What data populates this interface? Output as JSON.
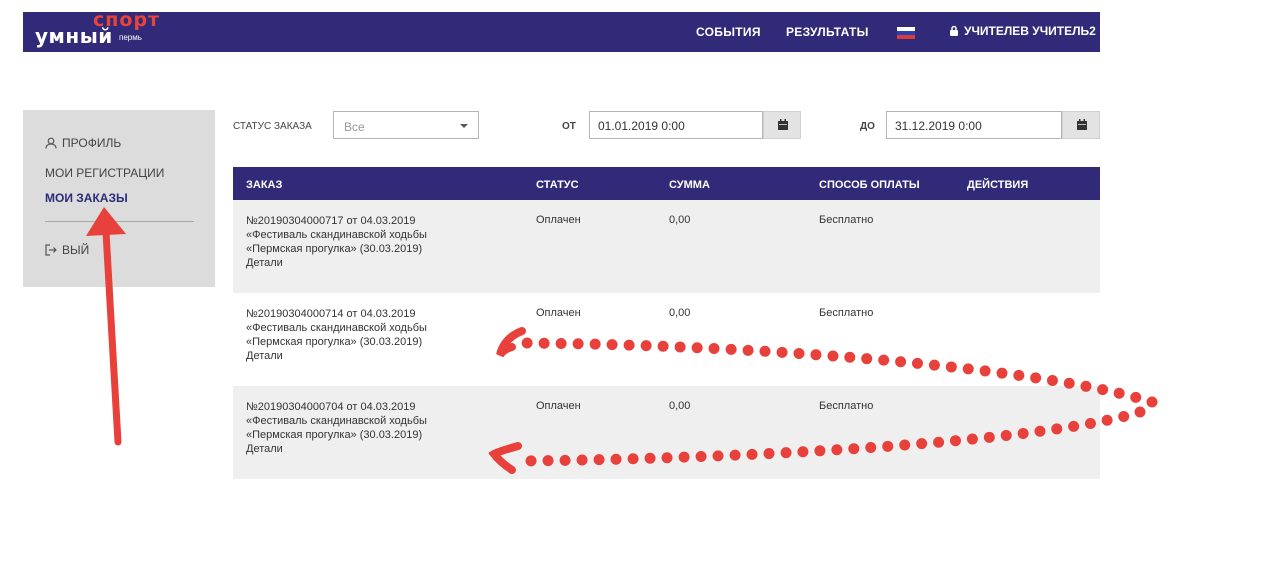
{
  "header": {
    "logo_main": "умный",
    "logo_sport": "спорт",
    "logo_city": "пермь",
    "nav": [
      {
        "label": "СОБЫТИЯ"
      },
      {
        "label": "РЕЗУЛЬТАТЫ"
      }
    ],
    "language_flag_icon": "russia-flag-icon",
    "user_icon": "lock-icon",
    "user_name": "УЧИТЕЛЕВ УЧИТЕЛЬ2"
  },
  "sidebar": {
    "items": [
      {
        "label": "ПРОФИЛЬ",
        "icon": "user-icon"
      },
      {
        "label": "МОИ РЕГИСТРАЦИИ"
      },
      {
        "label": "МОИ ЗАКАЗЫ",
        "active": true
      },
      {
        "label": "ВЫЙ",
        "icon": "logout-icon"
      }
    ]
  },
  "filters": {
    "status_label": "СТАТУС ЗАКАЗА",
    "status_value": "Все",
    "from_label": "от",
    "from_value": "01.01.2019 0:00",
    "to_label": "до",
    "to_value": "31.12.2019 0:00",
    "calendar_icon": "calendar-icon"
  },
  "table": {
    "columns": [
      "ЗАКАЗ",
      "СТАТУС",
      "СУММА",
      "СПОСОБ ОПЛАТЫ",
      "ДЕЙСТВИЯ"
    ],
    "rows": [
      {
        "order_line1": "№20190304000717 от 04.03.2019",
        "order_line2": "«Фестиваль скандинавской ходьбы",
        "order_line3": "«Пермская прогулка» (30.03.2019)",
        "details": "Детали",
        "status": "Оплачен",
        "sum": "0,00",
        "payment": "Бесплатно"
      },
      {
        "order_line1": "№20190304000714 от 04.03.2019",
        "order_line2": "«Фестиваль скандинавской ходьбы",
        "order_line3": "«Пермская прогулка» (30.03.2019)",
        "details": "Детали",
        "status": "Оплачен",
        "sum": "0,00",
        "payment": "Бесплатно"
      },
      {
        "order_line1": "№20190304000704 от 04.03.2019",
        "order_line2": "«Фестиваль скандинавской ходьбы",
        "order_line3": "«Пермская прогулка» (30.03.2019)",
        "details": "Детали",
        "status": "Оплачен",
        "sum": "0,00",
        "payment": "Бесплатно"
      }
    ]
  },
  "colors": {
    "brand_navy": "#312a78",
    "brand_red": "#e8443a",
    "annotation_red": "#e8403a"
  }
}
